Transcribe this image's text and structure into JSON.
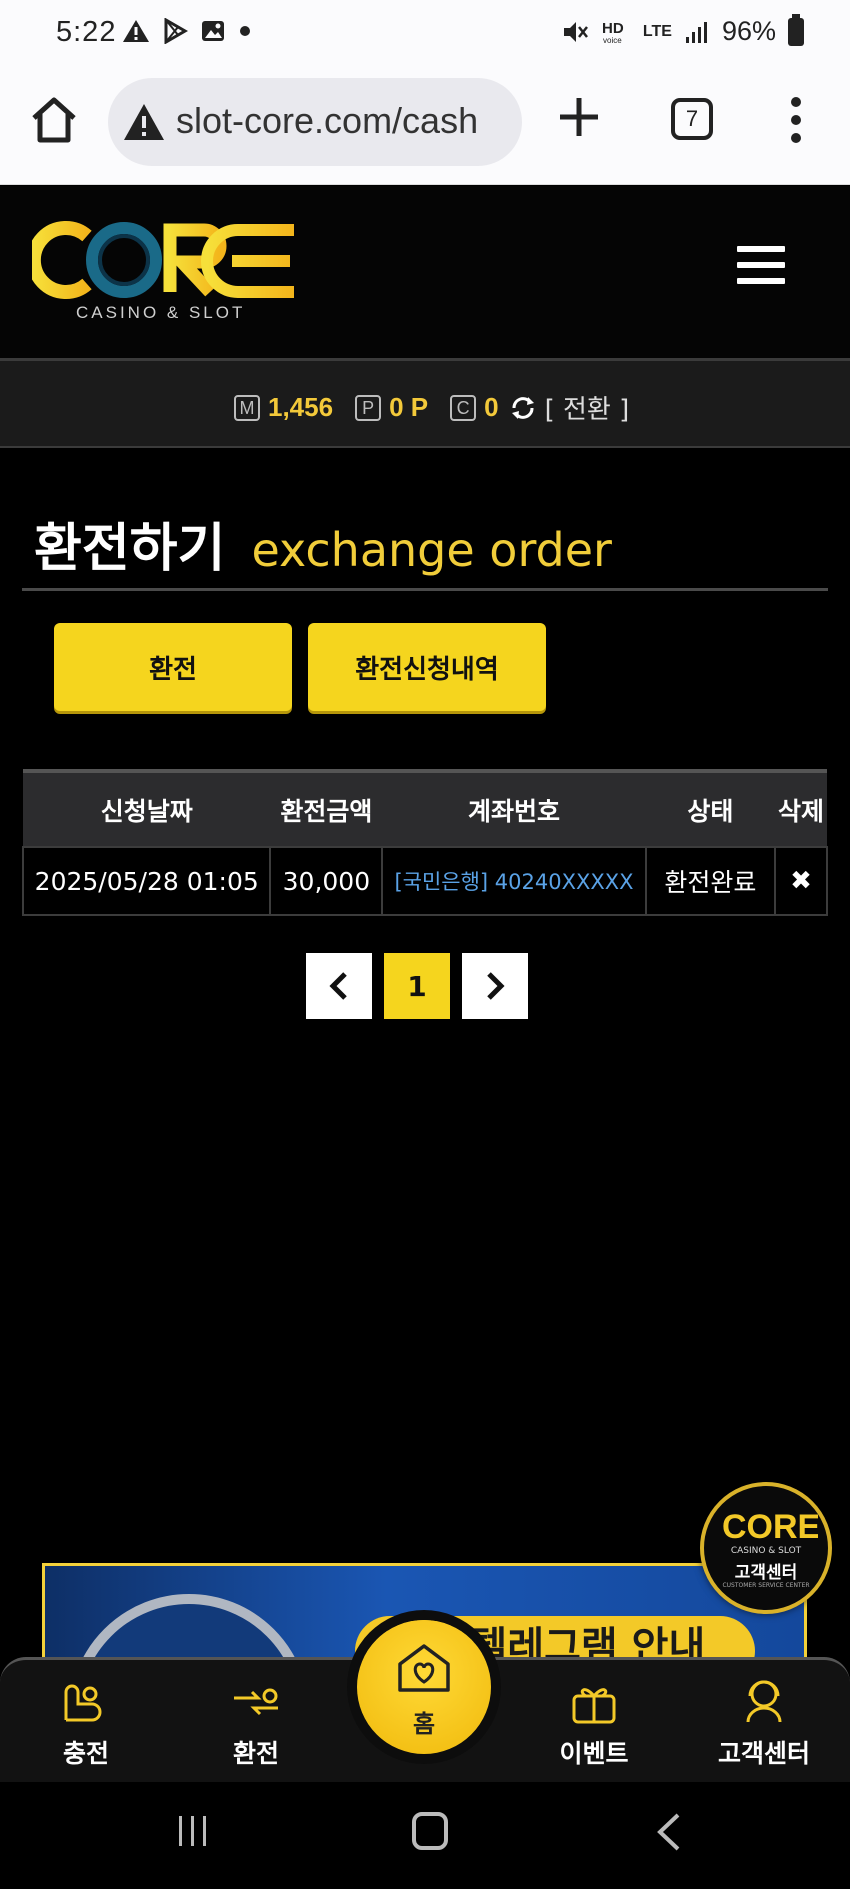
{
  "status_bar": {
    "time": "5:22",
    "network": "LTE",
    "battery": "96%"
  },
  "browser": {
    "url": "slot-core.com/cash",
    "tab_count": "7"
  },
  "header": {
    "logo_text": "CORE",
    "logo_sub": "CASINO & SLOT"
  },
  "points": {
    "m_label": "M",
    "m_value": "1,456",
    "p_label": "P",
    "p_value": "0 P",
    "c_label": "C",
    "c_value": "0",
    "switch_label": "[ 전환 ]"
  },
  "page": {
    "title_ko": "환전하기",
    "title_en": "exchange order"
  },
  "tabs": [
    {
      "label": "환전"
    },
    {
      "label": "환전신청내역"
    }
  ],
  "table": {
    "headers": [
      "신청날짜",
      "환전금액",
      "계좌번호",
      "상태",
      "삭제"
    ],
    "rows": [
      {
        "date": "2025/05/28 01:05",
        "amount": "30,000",
        "account": "[국민은행] 40240XXXXX",
        "status": "환전완료",
        "delete": "✖"
      }
    ]
  },
  "pagination": {
    "prev": "‹",
    "current": "1",
    "next": "›"
  },
  "banner": {
    "text": "코어 텔레그램 안내"
  },
  "support_float": {
    "logo": "CORE",
    "sub": "CASINO & SLOT",
    "label": "고객센터",
    "en": "CUSTOMER SERVICE CENTER"
  },
  "bottom_nav": {
    "items": [
      {
        "label": "충전",
        "icon": "deposit-icon"
      },
      {
        "label": "환전",
        "icon": "exchange-icon"
      },
      {
        "label": "홈",
        "icon": "home-heart-icon"
      },
      {
        "label": "이벤트",
        "icon": "gift-icon"
      },
      {
        "label": "고객센터",
        "icon": "support-icon"
      }
    ]
  },
  "colors": {
    "accent": "#f5d51e",
    "link": "#5aa2e6",
    "background": "#000000"
  }
}
